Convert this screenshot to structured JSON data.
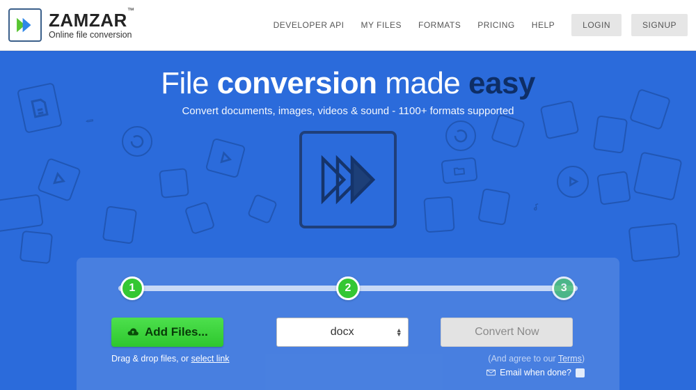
{
  "brand": {
    "name": "ZAMZAR",
    "tm": "™",
    "tagline": "Online file conversion"
  },
  "nav": {
    "items": [
      {
        "label": "DEVELOPER API"
      },
      {
        "label": "MY FILES"
      },
      {
        "label": "FORMATS"
      },
      {
        "label": "PRICING"
      },
      {
        "label": "HELP"
      }
    ],
    "login": "LOGIN",
    "signup": "SIGNUP"
  },
  "hero": {
    "h1_a": "File ",
    "h1_b": "conversion",
    "h1_c": " made ",
    "h1_d": "easy",
    "sub": "Convert documents, images, videos & sound - 1100+ formats supported"
  },
  "steps": {
    "s1": "1",
    "s2": "2",
    "s3": "3"
  },
  "converter": {
    "add_files_label": "Add Files...",
    "dragdrop_prefix": "Drag & drop files, or ",
    "dragdrop_link": "select link",
    "format_selected": "docx",
    "convert_label": "Convert Now",
    "agree_prefix": "(And agree to our ",
    "agree_link": "Terms",
    "agree_suffix": ")",
    "email_label": "Email when done?"
  }
}
